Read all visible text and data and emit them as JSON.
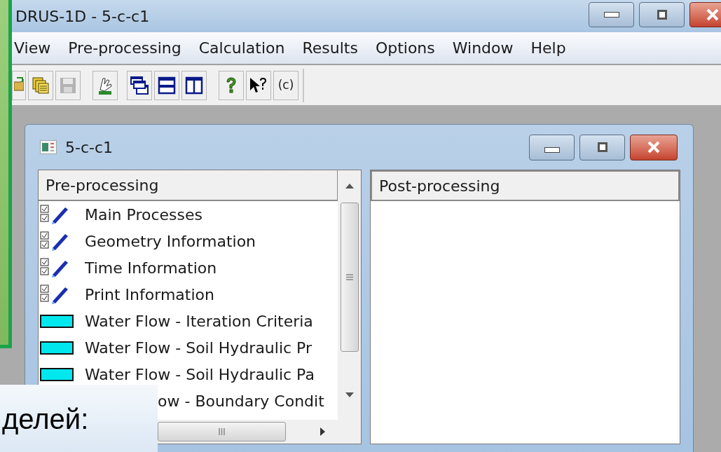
{
  "window": {
    "title": "DRUS-1D - 5-c-c1"
  },
  "menu": [
    "View",
    "Pre-processing",
    "Calculation",
    "Results",
    "Options",
    "Window",
    "Help"
  ],
  "toolbar": [
    {
      "kind": "open"
    },
    {
      "kind": "copy"
    },
    {
      "kind": "save",
      "disabled": true
    },
    {
      "kind": "hand"
    },
    {
      "kind": "cascade"
    },
    {
      "kind": "tile_h"
    },
    {
      "kind": "tile_v"
    },
    {
      "kind": "help"
    },
    {
      "kind": "context_help"
    },
    {
      "kind": "text",
      "label": "(c)"
    }
  ],
  "child_window": {
    "title": "5-c-c1",
    "pre_processing": {
      "header": "Pre-processing",
      "items": [
        {
          "kind": "check",
          "label": "Main Processes"
        },
        {
          "kind": "check",
          "label": "Geometry Information"
        },
        {
          "kind": "check",
          "label": "Time Information"
        },
        {
          "kind": "check",
          "label": "Print Information"
        },
        {
          "kind": "water",
          "label": "Water Flow - Iteration Criteria"
        },
        {
          "kind": "water",
          "label": "Water Flow - Soil Hydraulic Pr"
        },
        {
          "kind": "water",
          "label": "Water Flow - Soil Hydraulic Pa"
        },
        {
          "kind": "covered",
          "label": "ow - Boundary Condit"
        }
      ]
    },
    "post_processing": {
      "header": "Post-processing"
    }
  },
  "slide_caption": "делей:"
}
